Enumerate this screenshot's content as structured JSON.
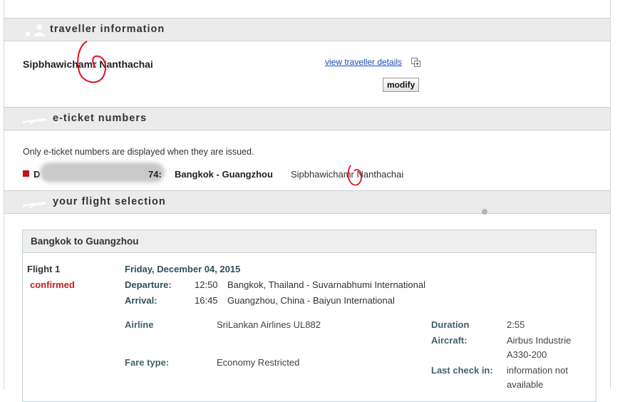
{
  "traveller": {
    "section_title": "traveller information",
    "name_first": "Sipbhawichamr",
    "name_last": "Nanthachai",
    "view_details_link": "view traveller details",
    "modify_button": "modify"
  },
  "eticket": {
    "section_title": "e-ticket numbers",
    "note": "Only e-ticket numbers are displayed when they are issued.",
    "ticket_prefix": "D",
    "ticket_suffix": "74:",
    "route": "Bangkok - Guangzhou",
    "passenger": "Sipbhawichamr Nanthachai"
  },
  "selection": {
    "section_title": "your flight selection",
    "box_title": "Bangkok to Guangzhou",
    "flight_label": "Flight 1",
    "status": "confirmed",
    "date": "Friday, December 04, 2015",
    "departure_label": "Departure:",
    "departure_time": "12:50",
    "departure_place": "Bangkok, Thailand - Suvarnabhumi International",
    "arrival_label": "Arrival:",
    "arrival_time": "16:45",
    "arrival_place": "Guangzhou, China - Baiyun International",
    "airline_label": "Airline",
    "airline_value": "SriLankan Airlines UL882",
    "fare_label": "Fare type:",
    "fare_value": "Economy Restricted",
    "duration_label": "Duration",
    "duration_value": "2:55",
    "aircraft_label": "Aircraft:",
    "aircraft_value_1": "Airbus Industrie",
    "aircraft_value_2": "A330-200",
    "checkin_label": "Last check in:",
    "checkin_value_1": "information not",
    "checkin_value_2": "available"
  },
  "colors": {
    "status": "#cc1a1a",
    "link": "#1a4db5",
    "ticket_square": "#c0141b",
    "annotation": "#e01020"
  }
}
